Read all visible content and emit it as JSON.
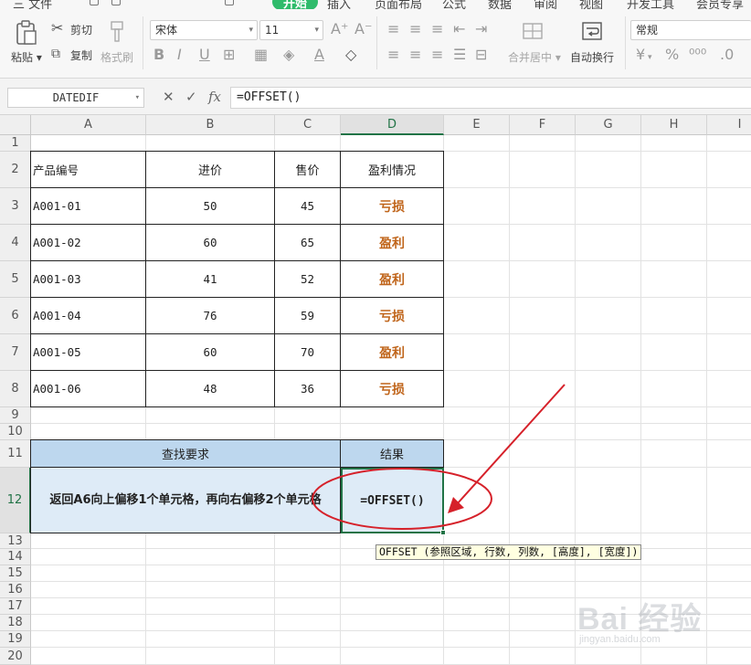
{
  "menu": {
    "items": [
      "三 文件",
      "开始",
      "插入",
      "页面布局",
      "公式",
      "数据",
      "审阅",
      "视图",
      "开发工具",
      "会员专享"
    ],
    "active_index": 1
  },
  "ribbon": {
    "paste_label": "粘贴",
    "cut_label": "剪切",
    "copy_label": "复制",
    "format_painter_label": "格式刷",
    "font_name": "宋体",
    "font_size": "11",
    "merge_center_label": "合并居中",
    "wrap_text_label": "自动换行",
    "number_format": "常规",
    "percent_symbol": "%",
    "currency_symbol": "¥"
  },
  "formula_bar": {
    "name_box": "DATEDIF",
    "cancel_icon": "✕",
    "confirm_icon": "✓",
    "fx_icon": "fx",
    "formula": "=OFFSET()"
  },
  "columns": [
    "A",
    "B",
    "C",
    "D",
    "E",
    "F",
    "G",
    "H",
    "I"
  ],
  "rows": [
    "1",
    "2",
    "3",
    "4",
    "5",
    "6",
    "7",
    "8",
    "9",
    "10",
    "11",
    "12",
    "13",
    "14",
    "15",
    "16",
    "17",
    "18",
    "19",
    "20"
  ],
  "table": {
    "headers": [
      "产品编号",
      "进价",
      "售价",
      "盈利情况"
    ],
    "rows": [
      [
        "A001-01",
        "50",
        "45",
        "亏损"
      ],
      [
        "A001-02",
        "60",
        "65",
        "盈利"
      ],
      [
        "A001-03",
        "41",
        "52",
        "盈利"
      ],
      [
        "A001-04",
        "76",
        "59",
        "亏损"
      ],
      [
        "A001-05",
        "60",
        "70",
        "盈利"
      ],
      [
        "A001-06",
        "48",
        "36",
        "亏损"
      ]
    ]
  },
  "lookup": {
    "requirement_header": "查找要求",
    "result_header": "结果",
    "requirement_text": "返回A6向上偏移1个单元格，再向右偏移2个单元格",
    "result_text": "=OFFSET()"
  },
  "tooltip": "OFFSET (参照区域, 行数, 列数, [高度], [宽度])",
  "watermark": {
    "main": "Bai 经验",
    "sub": "jingyan.baidu.com"
  },
  "colors": {
    "accent_green": "#217346",
    "status_orange": "#c0651b",
    "header_blue": "#bdd7ee",
    "light_blue": "#deebf7",
    "annotation_red": "#d6212a"
  }
}
